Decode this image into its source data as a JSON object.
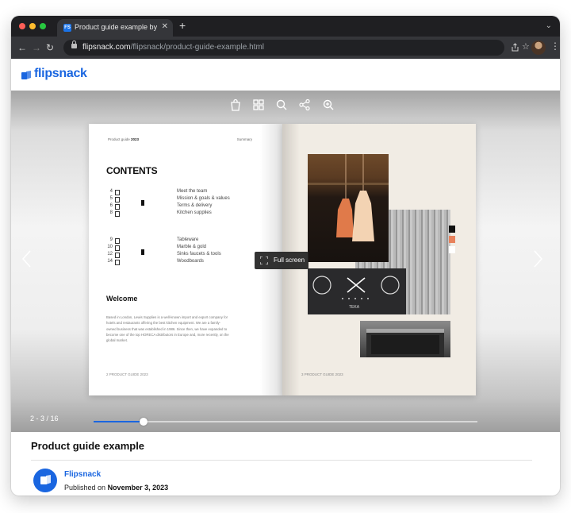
{
  "browser": {
    "tab_title": "Product guide example by Flipsnack",
    "tab_favicon": "FS",
    "url_host": "flipsnack.com",
    "url_path": "/flipsnack/product-guide-example.html"
  },
  "site": {
    "logo_text": "flipsnack",
    "brand_color": "#1a66e0"
  },
  "viewer": {
    "toolbar_icons": [
      "shopping-bag-icon",
      "grid-icon",
      "search-icon",
      "share-icon",
      "zoom-in-icon"
    ],
    "fullscreen_label": "Full screen",
    "page_count": "2 - 3 / 16",
    "progress": 0.13
  },
  "left_page": {
    "header_prefix": "Product guide",
    "header_year": "2023",
    "header_right": "Summary",
    "contents_title": "CONTENTS",
    "toc": [
      {
        "num": "4",
        "title": "Meet the team"
      },
      {
        "num": "5",
        "title": "Mission & goals & values"
      },
      {
        "num": "6",
        "title": "Terms & delivery"
      },
      {
        "num": "8",
        "title": "Kitchen supplies"
      },
      {
        "num": "9",
        "title": "Tableware"
      },
      {
        "num": "10",
        "title": "Marble & gold"
      },
      {
        "num": "12",
        "title": "Sinks faucets & tools"
      },
      {
        "num": "14",
        "title": "Woodboards"
      }
    ],
    "welcome_title": "Welcome",
    "welcome_text": "Based in London, Lewis Supplies is a well-known import and export company for hotels and restaurants offering the best kitchen equipment. We are a family-owned business that was established in 1986. Since then, we have expanded to become one of the top HORECA distributors in Europe and, more recently, on the global market.",
    "footer": "2  PRODUCT GUIDE 2023"
  },
  "right_page": {
    "hob_brand": "TEKA",
    "footer": "3  PRODUCT GUIDE 2023",
    "swatches": [
      "#111111",
      "#e8825c",
      "#ffffff"
    ]
  },
  "info": {
    "title": "Product guide example",
    "author": "Flipsnack",
    "published_prefix": "Published on",
    "published_date": "November 3, 2023"
  }
}
